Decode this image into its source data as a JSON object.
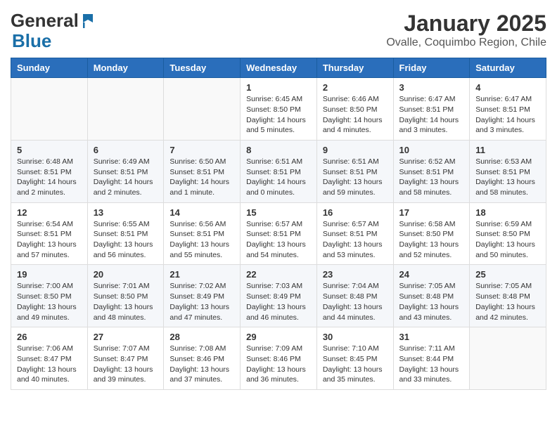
{
  "header": {
    "logo_general": "General",
    "logo_blue": "Blue",
    "title": "January 2025",
    "subtitle": "Ovalle, Coquimbo Region, Chile"
  },
  "days_of_week": [
    "Sunday",
    "Monday",
    "Tuesday",
    "Wednesday",
    "Thursday",
    "Friday",
    "Saturday"
  ],
  "weeks": [
    {
      "days": [
        {
          "num": "",
          "info": ""
        },
        {
          "num": "",
          "info": ""
        },
        {
          "num": "",
          "info": ""
        },
        {
          "num": "1",
          "info": "Sunrise: 6:45 AM\nSunset: 8:50 PM\nDaylight: 14 hours\nand 5 minutes."
        },
        {
          "num": "2",
          "info": "Sunrise: 6:46 AM\nSunset: 8:50 PM\nDaylight: 14 hours\nand 4 minutes."
        },
        {
          "num": "3",
          "info": "Sunrise: 6:47 AM\nSunset: 8:51 PM\nDaylight: 14 hours\nand 3 minutes."
        },
        {
          "num": "4",
          "info": "Sunrise: 6:47 AM\nSunset: 8:51 PM\nDaylight: 14 hours\nand 3 minutes."
        }
      ]
    },
    {
      "days": [
        {
          "num": "5",
          "info": "Sunrise: 6:48 AM\nSunset: 8:51 PM\nDaylight: 14 hours\nand 2 minutes."
        },
        {
          "num": "6",
          "info": "Sunrise: 6:49 AM\nSunset: 8:51 PM\nDaylight: 14 hours\nand 2 minutes."
        },
        {
          "num": "7",
          "info": "Sunrise: 6:50 AM\nSunset: 8:51 PM\nDaylight: 14 hours\nand 1 minute."
        },
        {
          "num": "8",
          "info": "Sunrise: 6:51 AM\nSunset: 8:51 PM\nDaylight: 14 hours\nand 0 minutes."
        },
        {
          "num": "9",
          "info": "Sunrise: 6:51 AM\nSunset: 8:51 PM\nDaylight: 13 hours\nand 59 minutes."
        },
        {
          "num": "10",
          "info": "Sunrise: 6:52 AM\nSunset: 8:51 PM\nDaylight: 13 hours\nand 58 minutes."
        },
        {
          "num": "11",
          "info": "Sunrise: 6:53 AM\nSunset: 8:51 PM\nDaylight: 13 hours\nand 58 minutes."
        }
      ]
    },
    {
      "days": [
        {
          "num": "12",
          "info": "Sunrise: 6:54 AM\nSunset: 8:51 PM\nDaylight: 13 hours\nand 57 minutes."
        },
        {
          "num": "13",
          "info": "Sunrise: 6:55 AM\nSunset: 8:51 PM\nDaylight: 13 hours\nand 56 minutes."
        },
        {
          "num": "14",
          "info": "Sunrise: 6:56 AM\nSunset: 8:51 PM\nDaylight: 13 hours\nand 55 minutes."
        },
        {
          "num": "15",
          "info": "Sunrise: 6:57 AM\nSunset: 8:51 PM\nDaylight: 13 hours\nand 54 minutes."
        },
        {
          "num": "16",
          "info": "Sunrise: 6:57 AM\nSunset: 8:51 PM\nDaylight: 13 hours\nand 53 minutes."
        },
        {
          "num": "17",
          "info": "Sunrise: 6:58 AM\nSunset: 8:50 PM\nDaylight: 13 hours\nand 52 minutes."
        },
        {
          "num": "18",
          "info": "Sunrise: 6:59 AM\nSunset: 8:50 PM\nDaylight: 13 hours\nand 50 minutes."
        }
      ]
    },
    {
      "days": [
        {
          "num": "19",
          "info": "Sunrise: 7:00 AM\nSunset: 8:50 PM\nDaylight: 13 hours\nand 49 minutes."
        },
        {
          "num": "20",
          "info": "Sunrise: 7:01 AM\nSunset: 8:50 PM\nDaylight: 13 hours\nand 48 minutes."
        },
        {
          "num": "21",
          "info": "Sunrise: 7:02 AM\nSunset: 8:49 PM\nDaylight: 13 hours\nand 47 minutes."
        },
        {
          "num": "22",
          "info": "Sunrise: 7:03 AM\nSunset: 8:49 PM\nDaylight: 13 hours\nand 46 minutes."
        },
        {
          "num": "23",
          "info": "Sunrise: 7:04 AM\nSunset: 8:48 PM\nDaylight: 13 hours\nand 44 minutes."
        },
        {
          "num": "24",
          "info": "Sunrise: 7:05 AM\nSunset: 8:48 PM\nDaylight: 13 hours\nand 43 minutes."
        },
        {
          "num": "25",
          "info": "Sunrise: 7:05 AM\nSunset: 8:48 PM\nDaylight: 13 hours\nand 42 minutes."
        }
      ]
    },
    {
      "days": [
        {
          "num": "26",
          "info": "Sunrise: 7:06 AM\nSunset: 8:47 PM\nDaylight: 13 hours\nand 40 minutes."
        },
        {
          "num": "27",
          "info": "Sunrise: 7:07 AM\nSunset: 8:47 PM\nDaylight: 13 hours\nand 39 minutes."
        },
        {
          "num": "28",
          "info": "Sunrise: 7:08 AM\nSunset: 8:46 PM\nDaylight: 13 hours\nand 37 minutes."
        },
        {
          "num": "29",
          "info": "Sunrise: 7:09 AM\nSunset: 8:46 PM\nDaylight: 13 hours\nand 36 minutes."
        },
        {
          "num": "30",
          "info": "Sunrise: 7:10 AM\nSunset: 8:45 PM\nDaylight: 13 hours\nand 35 minutes."
        },
        {
          "num": "31",
          "info": "Sunrise: 7:11 AM\nSunset: 8:44 PM\nDaylight: 13 hours\nand 33 minutes."
        },
        {
          "num": "",
          "info": ""
        }
      ]
    }
  ]
}
